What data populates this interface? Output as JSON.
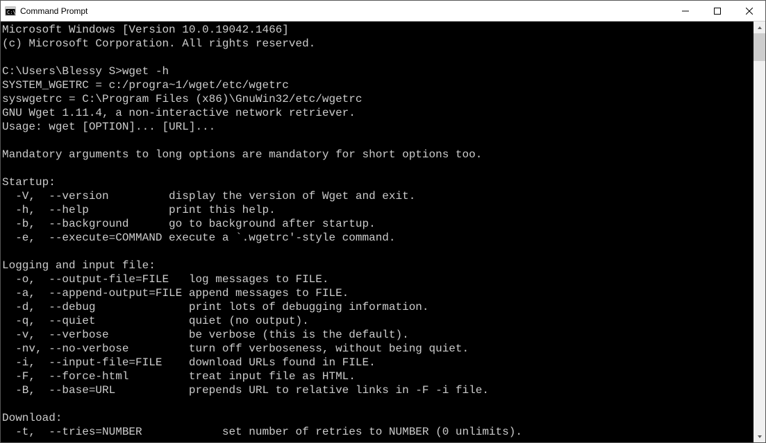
{
  "window": {
    "title": "Command Prompt"
  },
  "terminal": {
    "prompt": "C:\\Users\\Blessy S>",
    "command": "wget -h",
    "header_lines": [
      "Microsoft Windows [Version 10.0.19042.1466]",
      "(c) Microsoft Corporation. All rights reserved.",
      ""
    ],
    "post_lines": [
      "SYSTEM_WGETRC = c:/progra~1/wget/etc/wgetrc",
      "syswgetrc = C:\\Program Files (x86)\\GnuWin32/etc/wgetrc",
      "GNU Wget 1.11.4, a non-interactive network retriever.",
      "Usage: wget [OPTION]... [URL]...",
      "",
      "Mandatory arguments to long options are mandatory for short options too.",
      ""
    ],
    "sections": [
      {
        "title": "Startup:",
        "pad": 25,
        "options": [
          {
            "flags": "  -V,  --version",
            "desc": "display the version of Wget and exit."
          },
          {
            "flags": "  -h,  --help",
            "desc": "print this help."
          },
          {
            "flags": "  -b,  --background",
            "desc": "go to background after startup."
          },
          {
            "flags": "  -e,  --execute=COMMAND",
            "desc": "execute a `.wgetrc'-style command."
          }
        ]
      },
      {
        "title": "Logging and input file:",
        "pad": 28,
        "options": [
          {
            "flags": "  -o,  --output-file=FILE",
            "desc": "log messages to FILE."
          },
          {
            "flags": "  -a,  --append-output=FILE",
            "desc": "append messages to FILE."
          },
          {
            "flags": "  -d,  --debug",
            "desc": "print lots of debugging information."
          },
          {
            "flags": "  -q,  --quiet",
            "desc": "quiet (no output)."
          },
          {
            "flags": "  -v,  --verbose",
            "desc": "be verbose (this is the default)."
          },
          {
            "flags": "  -nv, --no-verbose",
            "desc": "turn off verboseness, without being quiet."
          },
          {
            "flags": "  -i,  --input-file=FILE",
            "desc": "download URLs found in FILE."
          },
          {
            "flags": "  -F,  --force-html",
            "desc": "treat input file as HTML."
          },
          {
            "flags": "  -B,  --base=URL",
            "desc": "prepends URL to relative links in -F -i file."
          }
        ]
      },
      {
        "title": "Download:",
        "pad": 33,
        "options": [
          {
            "flags": "  -t,  --tries=NUMBER",
            "desc": "set number of retries to NUMBER (0 unlimits)."
          }
        ]
      }
    ]
  }
}
